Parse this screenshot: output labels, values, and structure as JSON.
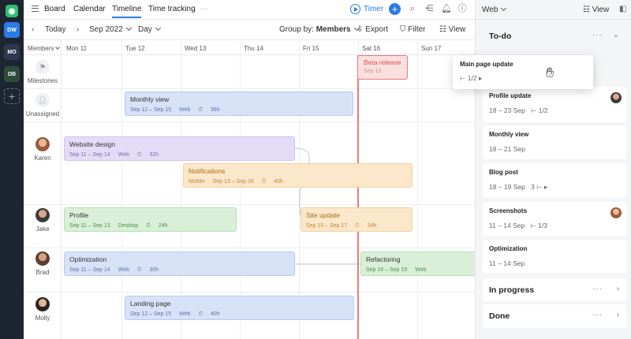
{
  "rail": {
    "workspaces": [
      {
        "label": "DW",
        "color": "#2a7be4"
      },
      {
        "label": "MO",
        "color": "#2e3950"
      },
      {
        "label": "DB",
        "color": "#2d4a3a"
      }
    ]
  },
  "topnav": {
    "items": [
      "Board",
      "Calendar",
      "Timeline",
      "Time tracking",
      "···"
    ],
    "active": "Timeline",
    "timer_label": "Timer"
  },
  "toolbar": {
    "today": "Today",
    "month": "Sep 2022",
    "scale": "Day",
    "group_by_prefix": "Group by:",
    "group_by_value": "Members",
    "export": "Export",
    "filter": "Filter",
    "view": "View"
  },
  "grid": {
    "members_label": "Members",
    "days": [
      "Mon 11",
      "Tue 12",
      "Wed 13",
      "Thu 14",
      "Fri 15",
      "Sat 16",
      "Sun 17"
    ],
    "rows": [
      "Milestones",
      "Unassigned",
      "Karen",
      "Jake",
      "Brad",
      "Molly"
    ]
  },
  "milestone": {
    "title": "Beta release",
    "date": "Sep 18"
  },
  "bars": [
    {
      "title": "Monthly view",
      "dates": "Sep 12 – Sep 15",
      "platform": "Web",
      "time": "36h"
    },
    {
      "title": "Website design",
      "dates": "Sep 11 – Sep 14",
      "platform": "Web",
      "time": "32h"
    },
    {
      "title": "Notifications",
      "dates": "Sep 13 – Sep 16",
      "platform": "Mobile",
      "time": "40h"
    },
    {
      "title": "Profile",
      "dates": "Sep 11 – Sep 13",
      "platform": "Desktop",
      "time": "24h"
    },
    {
      "title": "Site update",
      "dates": "Sep 15 – Sep 17",
      "platform": "Web",
      "time": "24h"
    },
    {
      "title": "Optimization",
      "dates": "Sep 11 – Sep 14",
      "platform": "Web",
      "time": "30h"
    },
    {
      "title": "Refactoring",
      "dates": "Sep 16 – Sep 19",
      "platform": "Web",
      "time": ""
    },
    {
      "title": "Landing page",
      "dates": "Sep 12 – Sep 15",
      "platform": "Web",
      "time": "40h"
    }
  ],
  "rpanel": {
    "filter": "Web",
    "view": "View",
    "todo_title": "To-do",
    "popup": {
      "title": "Main page update",
      "subtasks": "1/2"
    },
    "cards": [
      {
        "title": "Profile update",
        "dates": "18 – 23 Sep",
        "subtasks": "1/2"
      },
      {
        "title": "Monthly view",
        "dates": "18 – 21 Sep",
        "subtasks": ""
      },
      {
        "title": "Blog post",
        "dates": "18 – 19 Sep",
        "subtasks": "3"
      },
      {
        "title": "Screenshots",
        "dates": "11 – 14 Sep",
        "subtasks": "1/3"
      },
      {
        "title": "Optimization",
        "dates": "11 – 14 Sep",
        "subtasks": ""
      }
    ],
    "inprogress_title": "In progress",
    "done_title": "Done"
  }
}
